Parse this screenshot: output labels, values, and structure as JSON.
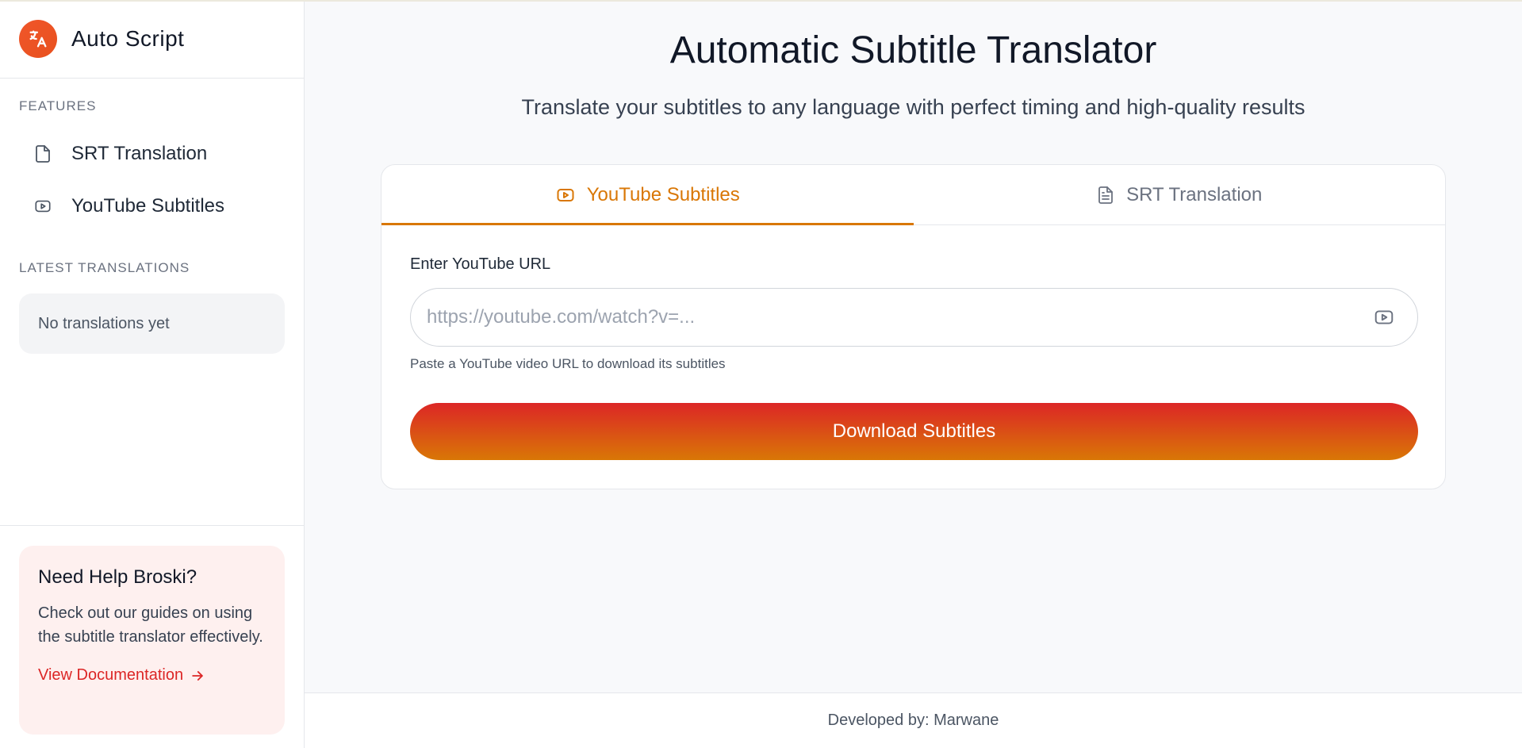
{
  "app": {
    "title": "Auto Script"
  },
  "sidebar": {
    "features_label": "FEATURES",
    "items": [
      {
        "label": "SRT Translation",
        "icon": "file-icon"
      },
      {
        "label": "YouTube Subtitles",
        "icon": "youtube-icon"
      }
    ],
    "latest_label": "LATEST TRANSLATIONS",
    "latest_empty": "No translations yet",
    "help": {
      "title": "Need Help Broski?",
      "text": "Check out our guides on using the subtitle translator effectively.",
      "link": "View Documentation"
    }
  },
  "main": {
    "title": "Automatic Subtitle Translator",
    "subtitle": "Translate your subtitles to any language with perfect timing and high-quality results",
    "tabs": [
      {
        "label": "YouTube Subtitles",
        "icon": "youtube-icon",
        "active": true
      },
      {
        "label": "SRT Translation",
        "icon": "file-text-icon",
        "active": false
      }
    ],
    "url_label": "Enter YouTube URL",
    "url_value": "",
    "url_placeholder": "https://youtube.com/watch?v=...",
    "url_hint": "Paste a YouTube video URL to download its subtitles",
    "submit_label": "Download Subtitles"
  },
  "footer": {
    "text": "Developed by: Marwane"
  },
  "colors": {
    "accent": "#d97706",
    "brand": "#e8511e",
    "danger": "#dc2626",
    "button_gradient_start": "#dc2626",
    "button_gradient_end": "#d97706"
  }
}
